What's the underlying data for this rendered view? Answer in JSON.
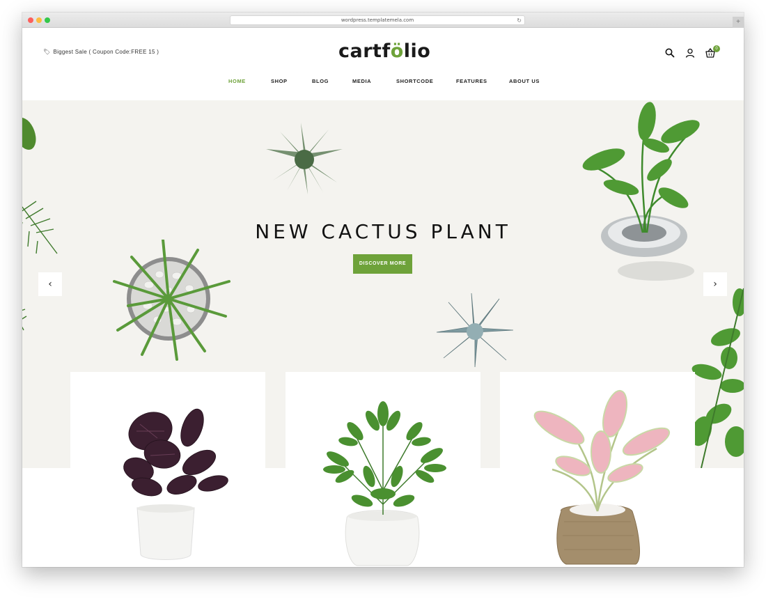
{
  "browser": {
    "url": "wordpress.templatemela.com",
    "reload_icon": "reload-icon",
    "new_tab_label": "+"
  },
  "header": {
    "promo_text": "Biggest Sale ( Coupon Code:FREE 15 )",
    "promo_icon": "tag-icon",
    "logo_prefix": "cartf",
    "logo_o": "ö",
    "logo_suffix": "lio",
    "cart_count": "0",
    "icons": [
      "search-icon",
      "user-icon",
      "cart-icon"
    ]
  },
  "nav": {
    "items": [
      {
        "label": "HOME",
        "active": true
      },
      {
        "label": "SHOP",
        "active": false
      },
      {
        "label": "BLOG",
        "active": false
      },
      {
        "label": "MEDIA",
        "active": false
      },
      {
        "label": "SHORTCODE",
        "active": false
      },
      {
        "label": "FEATURES",
        "active": false
      },
      {
        "label": "ABOUT US",
        "active": false
      }
    ]
  },
  "hero": {
    "title": "NEW CACTUS PLANT",
    "button_label": "DISCOVER MORE",
    "prev_arrow": "‹",
    "next_arrow": "›"
  },
  "colors": {
    "accent": "#6ea23a",
    "hero_bg": "#f4f3ef",
    "text": "#222222"
  },
  "products": [
    "dark-calathea-plant",
    "schefflera-plant",
    "pink-aglaonema-plant"
  ]
}
